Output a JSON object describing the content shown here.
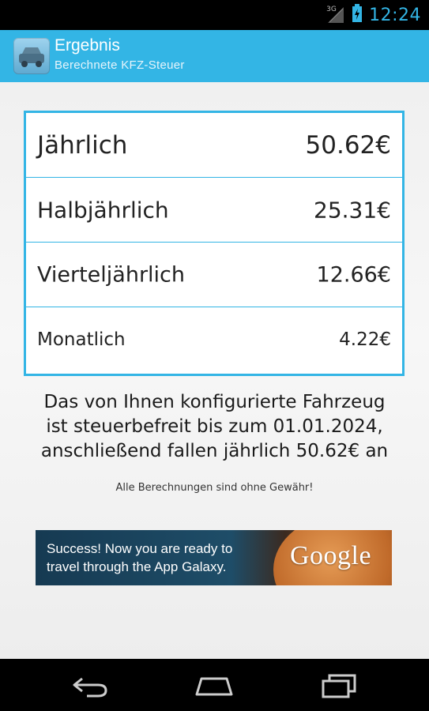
{
  "status_bar": {
    "network_type": "3G",
    "time": "12:24"
  },
  "action_bar": {
    "title": "Ergebnis",
    "subtitle": "Berechnete KFZ-Steuer"
  },
  "results": [
    {
      "label": "Jährlich",
      "value": "50.62€"
    },
    {
      "label": "Halbjährlich",
      "value": "25.31€"
    },
    {
      "label": "Vierteljährlich",
      "value": "12.66€"
    },
    {
      "label": "Monatlich",
      "value": "4.22€"
    }
  ],
  "info": {
    "lines": [
      "Das von Ihnen konfigurierte Fahrzeug",
      "ist steuerbefreit bis zum 01.01.2024,",
      "anschließend fallen jährlich 50.62€ an"
    ],
    "disclaimer": "Alle Berechnungen sind ohne Gewähr!"
  },
  "ad": {
    "line1": "Success! Now you are ready to",
    "line2": "travel through the App Galaxy.",
    "brand": "Google"
  },
  "icons": {
    "app": "car-icon",
    "nav": [
      "back-icon",
      "home-icon",
      "recent-apps-icon"
    ]
  },
  "colors": {
    "accent": "#33b5e5",
    "background": "#f0f0f0"
  }
}
